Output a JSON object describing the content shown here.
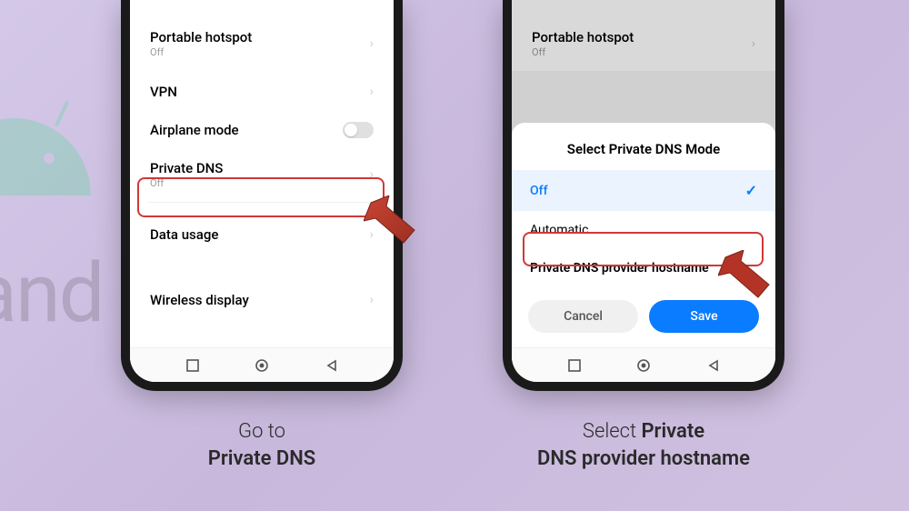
{
  "colors": {
    "highlight": "#d03838",
    "accent": "#0a7cff",
    "arrow": "#b33426"
  },
  "bg": {
    "word": "and"
  },
  "phone_left": {
    "rows": {
      "hotspot": {
        "title": "Portable hotspot",
        "sub": "Off"
      },
      "vpn": {
        "title": "VPN"
      },
      "airplane": {
        "title": "Airplane mode"
      },
      "private_dns": {
        "title": "Private DNS",
        "sub": "Off"
      },
      "data_usage": {
        "title": "Data usage"
      },
      "wireless_display": {
        "title": "Wireless display"
      }
    }
  },
  "phone_right": {
    "rows": {
      "hotspot": {
        "title": "Portable hotspot",
        "sub": "Off"
      }
    },
    "dialog": {
      "title": "Select Private DNS Mode",
      "options": {
        "off": "Off",
        "auto": "Automatic",
        "hostname": "Private DNS provider hostname"
      },
      "cancel": "Cancel",
      "save": "Save"
    }
  },
  "captions": {
    "left_line1": "Go to",
    "left_line2": "Private DNS",
    "right_prefix": "Select ",
    "right_bold1": "Private",
    "right_bold2": "DNS provider hostname"
  }
}
